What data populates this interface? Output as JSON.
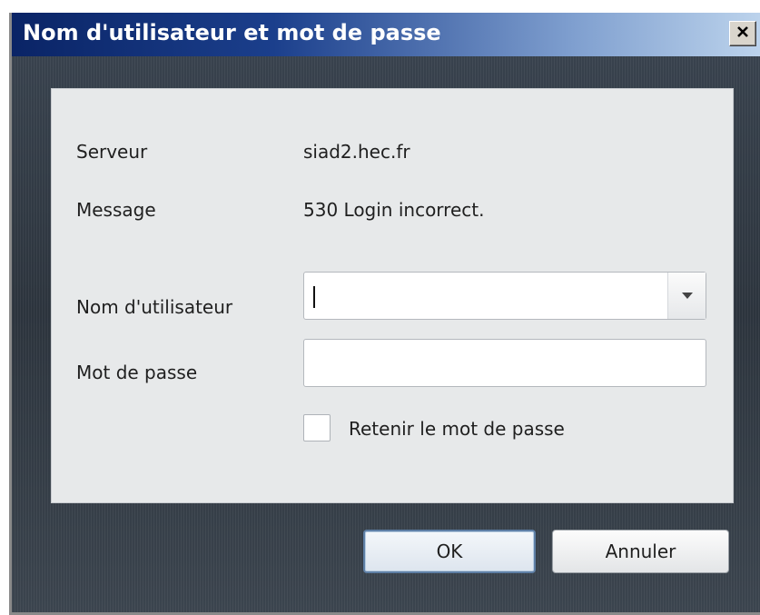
{
  "window": {
    "title": "Nom d'utilisateur et mot de passe",
    "close_icon": "close-icon"
  },
  "info": {
    "server_label": "Serveur",
    "server_value": "siad2.hec.fr",
    "message_label": "Message",
    "message_value": "530 Login incorrect."
  },
  "form": {
    "username_label": "Nom d'utilisateur",
    "username_value": "",
    "password_label": "Mot de passe",
    "password_value": "",
    "remember_label": "Retenir le mot de passe",
    "remember_checked": false
  },
  "buttons": {
    "ok_label": "OK",
    "cancel_label": "Annuler"
  },
  "colors": {
    "title_gradient_start": "#0a2466",
    "title_gradient_end": "#bcd3ec",
    "frame": "#2c343d",
    "panel": "#e7e9ea"
  }
}
